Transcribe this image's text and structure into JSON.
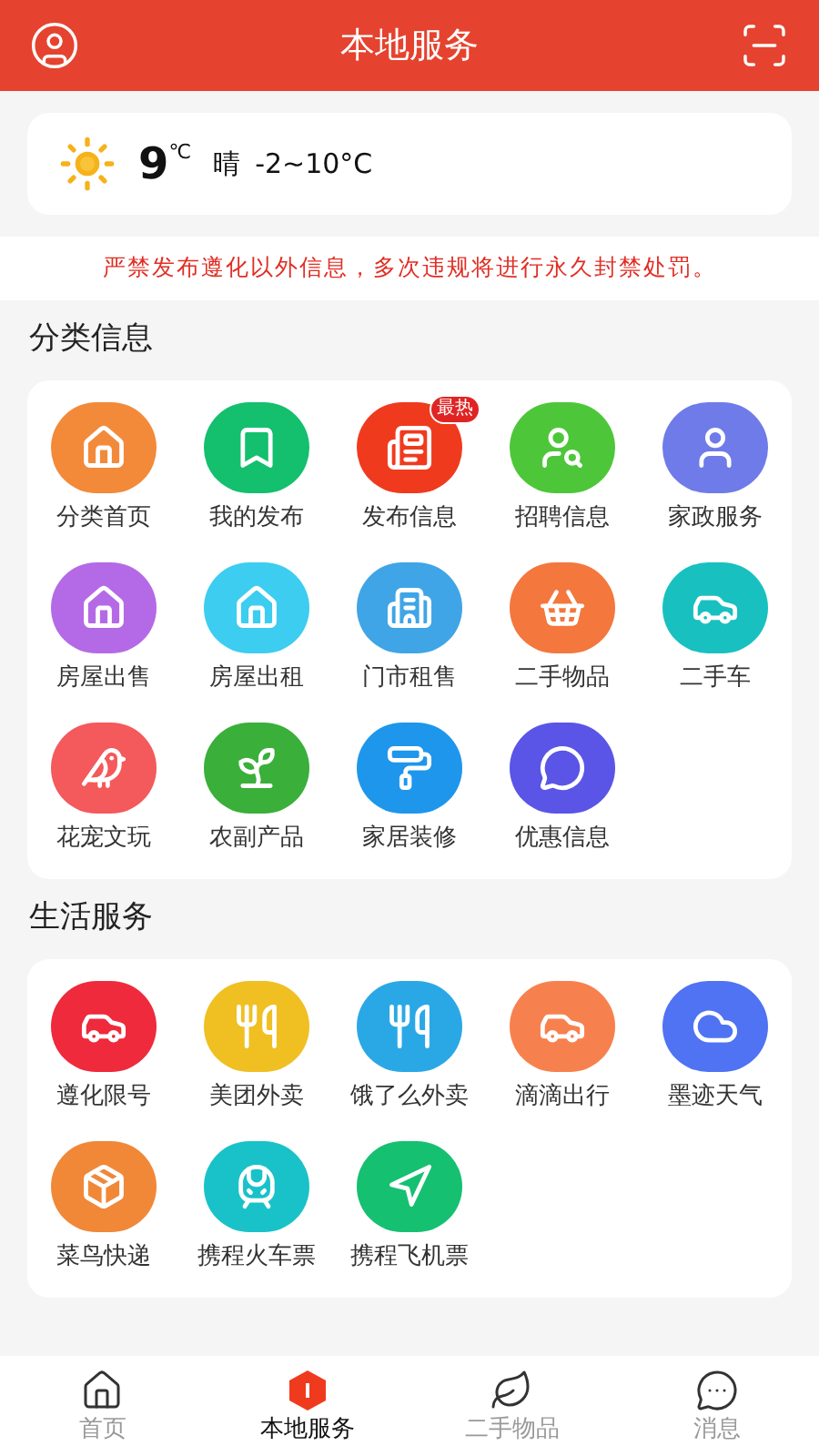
{
  "header": {
    "title": "本地服务"
  },
  "weather": {
    "temp": "9",
    "unit": "℃",
    "condition": "晴",
    "range": "-2~10°C"
  },
  "notice": "严禁发布遵化以外信息，多次违规将进行永久封禁处罚。",
  "sections": [
    {
      "title": "分类信息",
      "items": [
        {
          "label": "分类首页",
          "color": "#f28a3a"
        },
        {
          "label": "我的发布",
          "color": "#14bf6e"
        },
        {
          "label": "发布信息",
          "color": "#f03a1e",
          "badge": "最热"
        },
        {
          "label": "招聘信息",
          "color": "#4ec63a"
        },
        {
          "label": "家政服务",
          "color": "#6f7be8"
        },
        {
          "label": "房屋出售",
          "color": "#b46ae6"
        },
        {
          "label": "房屋出租",
          "color": "#3ccdf0"
        },
        {
          "label": "门市租售",
          "color": "#3fa5e6"
        },
        {
          "label": "二手物品",
          "color": "#f4773e"
        },
        {
          "label": "二手车",
          "color": "#19c0c0"
        },
        {
          "label": "花宠文玩",
          "color": "#f4595b"
        },
        {
          "label": "农副产品",
          "color": "#3aaf3a"
        },
        {
          "label": "家居装修",
          "color": "#1e96ec"
        },
        {
          "label": "优惠信息",
          "color": "#5a55e6"
        }
      ]
    },
    {
      "title": "生活服务",
      "items": [
        {
          "label": "遵化限号",
          "color": "#ee2a3c"
        },
        {
          "label": "美团外卖",
          "color": "#f0bf22"
        },
        {
          "label": "饿了么外卖",
          "color": "#2aa8e6"
        },
        {
          "label": "滴滴出行",
          "color": "#f7814e"
        },
        {
          "label": "墨迹天气",
          "color": "#4f73f2"
        },
        {
          "label": "菜鸟快递",
          "color": "#f08838"
        },
        {
          "label": "携程火车票",
          "color": "#19c2c8"
        },
        {
          "label": "携程飞机票",
          "color": "#15c071"
        }
      ]
    }
  ],
  "tabs": [
    {
      "label": "首页",
      "selected": false
    },
    {
      "label": "本地服务",
      "selected": true
    },
    {
      "label": "二手物品",
      "selected": false
    },
    {
      "label": "消息",
      "selected": false
    }
  ]
}
